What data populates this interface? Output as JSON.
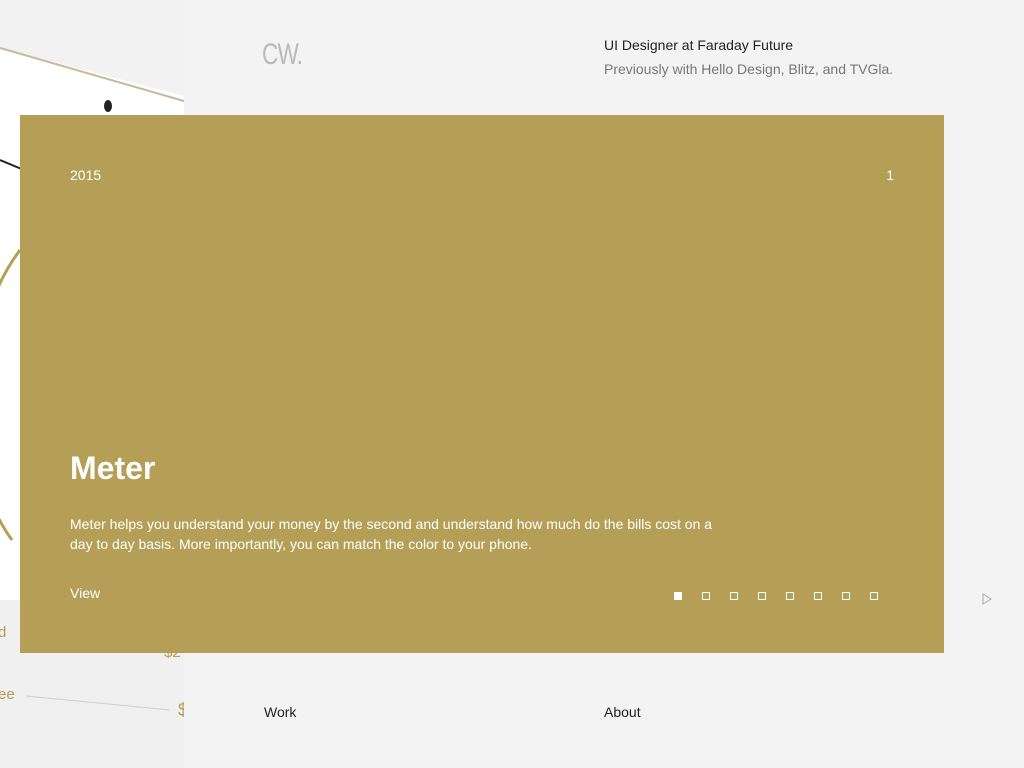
{
  "header": {
    "logo": "CW.",
    "role": "UI Designer at Faraday Future",
    "previous": "Previously with Hello Design, Blitz, and TVGla."
  },
  "preview": {
    "peek_texts": [
      "d",
      "$2",
      "ee",
      "$"
    ]
  },
  "slide": {
    "year": "2015",
    "index": "1",
    "title": "Meter",
    "description": "Meter helps you understand your money by the second and understand how much do the bills cost on a day to day basis. More importantly, you can match the color to your phone.",
    "view_label": "View",
    "background": "#b59f57",
    "pagination": {
      "total": 8,
      "current": 1
    }
  },
  "nav": {
    "next_icon": "next-arrow-icon",
    "work": "Work",
    "about": "About"
  }
}
